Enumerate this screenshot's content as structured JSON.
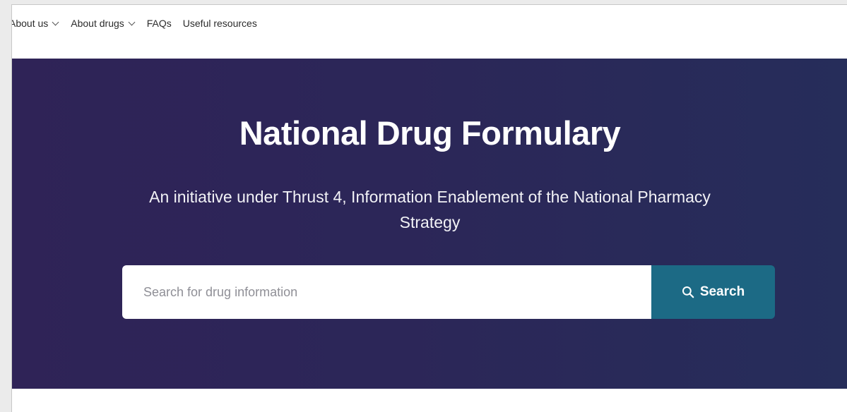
{
  "nav": {
    "items": [
      {
        "label": "About us",
        "has_dropdown": true
      },
      {
        "label": "About drugs",
        "has_dropdown": true
      },
      {
        "label": "FAQs",
        "has_dropdown": false
      },
      {
        "label": "Useful resources",
        "has_dropdown": false
      }
    ]
  },
  "hero": {
    "title": "National Drug Formulary",
    "subtitle": "An initiative under Thrust 4, Information Enablement of the National Pharmacy Strategy",
    "background_color": "#2c2658"
  },
  "search": {
    "placeholder": "Search for drug information",
    "value": "",
    "button_label": "Search",
    "button_icon": "search-icon",
    "button_color": "#1c6a85"
  },
  "icons": {
    "dropdown": "chevron-down-icon"
  }
}
